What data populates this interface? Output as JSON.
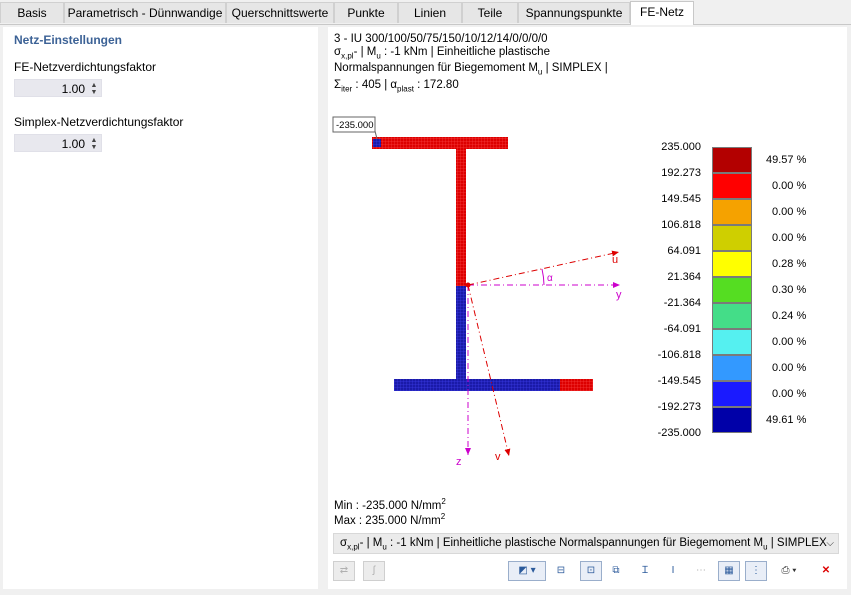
{
  "tabs": [
    {
      "label": "Basis"
    },
    {
      "label": "Parametrisch - Dünnwandige"
    },
    {
      "label": "Querschnittswerte"
    },
    {
      "label": "Punkte"
    },
    {
      "label": "Linien"
    },
    {
      "label": "Teile"
    },
    {
      "label": "Spannungspunkte"
    },
    {
      "label": "FE-Netz"
    }
  ],
  "active_tab": "FE-Netz",
  "settings": {
    "title": "Netz-Einstellungen",
    "fe_label": "FE-Netzverdichtungsfaktor",
    "fe_value": "1.00",
    "simplex_label": "Simplex-Netzverdichtungsfaktor",
    "simplex_value": "1.00"
  },
  "result": {
    "line1": "3 - IU 300/100/50/75/150/10/12/14/0/0/0/0",
    "line2_sigma": "σ",
    "line2_sub": "x,pl",
    "line2_rest": "- | M",
    "line2_sub2": "u",
    "line2_tail": " : -1 kNm | Einheitliche plastische",
    "line3_a": "Normalspannungen für Biegemoment M",
    "line3_sub": "u",
    "line3_b": " | SIMPLEX |",
    "line4_a": "Σ",
    "line4_sub": "iter",
    "line4_b": " : 405 | α",
    "line4_sub2": "plast",
    "line4_c": " : 172.80",
    "tag_value": "-235.000",
    "min_text": "Min : -235.000 N/mm",
    "max_text": "Max :  235.000 N/mm",
    "exp": "2"
  },
  "axes": {
    "u": "u",
    "y": "y",
    "z": "z",
    "v": "v",
    "alpha": "α"
  },
  "legend": [
    {
      "value": "235.000",
      "color": "#b30000",
      "pct": "49.57 %"
    },
    {
      "value": "192.273",
      "color": "#ff0000",
      "pct": "0.00 %"
    },
    {
      "value": "149.545",
      "color": "#f5a200",
      "pct": "0.00 %"
    },
    {
      "value": "106.818",
      "color": "#cfcf00",
      "pct": "0.00 %"
    },
    {
      "value": "64.091",
      "color": "#ffff00",
      "pct": "0.28 %"
    },
    {
      "value": "21.364",
      "color": "#55dd22",
      "pct": "0.30 %"
    },
    {
      "value": "-21.364",
      "color": "#44dd88",
      "pct": "0.24 %"
    },
    {
      "value": "-64.091",
      "color": "#55f0f0",
      "pct": "0.00 %"
    },
    {
      "value": "-106.818",
      "color": "#3399ff",
      "pct": "0.00 %"
    },
    {
      "value": "-149.545",
      "color": "#1a1aff",
      "pct": "0.00 %"
    },
    {
      "value": "-192.273",
      "color": "#0000a8",
      "pct": "49.61 %"
    },
    {
      "value": "-235.000",
      "color": null,
      "pct": null
    }
  ],
  "combo": {
    "a": "σ",
    "sub": "x,pl",
    "b": "- | M",
    "sub2": "u",
    "c": " : -1 kNm | Einheitliche plastische Normalspannungen für Biegemoment M",
    "sub3": "u",
    "d": " | SIMPLEX"
  },
  "toolbar_icons": [
    "result-table-icon",
    "section-icon",
    "graph-icon",
    "dimension-icon",
    "stress-point-icon",
    "numbering-icon",
    "centroid-icon",
    "axis-icon",
    "numbers-icon",
    "grid-icon",
    "legend-icon",
    "print-icon",
    "reset-view-icon"
  ]
}
